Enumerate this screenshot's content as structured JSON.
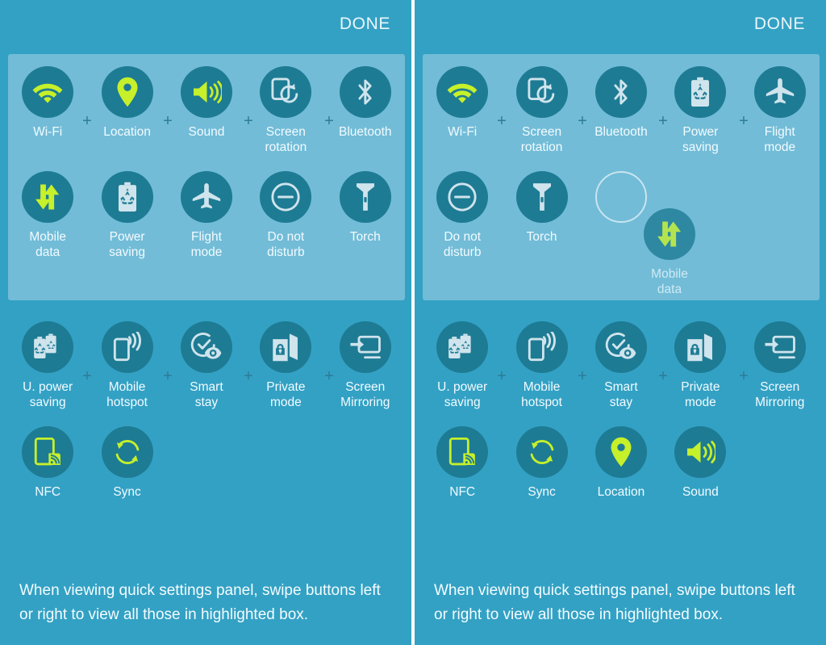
{
  "colors": {
    "panel_bg": "#33a1c4",
    "highlight_bg": "#72bcd7",
    "tile_circle": "#1e7b94",
    "icon_active": "#c6f02a",
    "icon_inactive": "#cfe4ec",
    "label": "#f2fbff",
    "plus": "#2c7c98",
    "divider": "#ffffff"
  },
  "panels": [
    {
      "id": "left-panel",
      "header": {
        "done_label": "DONE"
      },
      "highlight_rows": [
        {
          "tiles": [
            {
              "label": "Wi-Fi",
              "icon": "wifi-icon",
              "state": "active"
            },
            {
              "label": "Location",
              "icon": "location-pin-icon",
              "state": "active"
            },
            {
              "label": "Sound",
              "icon": "sound-speaker-icon",
              "state": "active"
            },
            {
              "label": "Screen\nrotation",
              "icon": "screen-rotation-icon",
              "state": "inactive"
            },
            {
              "label": "Bluetooth",
              "icon": "bluetooth-icon",
              "state": "inactive"
            }
          ]
        },
        {
          "tiles": [
            {
              "label": "Mobile\ndata",
              "icon": "mobile-data-icon",
              "state": "active"
            },
            {
              "label": "Power\nsaving",
              "icon": "power-saving-icon",
              "state": "inactive"
            },
            {
              "label": "Flight\nmode",
              "icon": "flight-mode-icon",
              "state": "inactive"
            },
            {
              "label": "Do not\ndisturb",
              "icon": "do-not-disturb-icon",
              "state": "inactive"
            },
            {
              "label": "Torch",
              "icon": "torch-icon",
              "state": "inactive"
            }
          ]
        }
      ],
      "lower_rows": [
        {
          "tiles": [
            {
              "label": "U. power\nsaving",
              "icon": "ultra-power-saving-icon",
              "state": "inactive"
            },
            {
              "label": "Mobile\nhotspot",
              "icon": "mobile-hotspot-icon",
              "state": "inactive"
            },
            {
              "label": "Smart\nstay",
              "icon": "smart-stay-icon",
              "state": "inactive"
            },
            {
              "label": "Private\nmode",
              "icon": "private-mode-icon",
              "state": "inactive"
            },
            {
              "label": "Screen\nMirroring",
              "icon": "screen-mirroring-icon",
              "state": "inactive"
            }
          ]
        },
        {
          "tiles": [
            {
              "label": "NFC",
              "icon": "nfc-icon",
              "state": "active"
            },
            {
              "label": "Sync",
              "icon": "sync-icon",
              "state": "active"
            },
            {
              "label": "",
              "icon": "",
              "state": "empty"
            },
            {
              "label": "",
              "icon": "",
              "state": "empty"
            },
            {
              "label": "",
              "icon": "",
              "state": "empty"
            }
          ]
        }
      ],
      "plus_marker": "+",
      "caption": "When viewing quick settings panel, swipe buttons left or right to view all those in highlighted box."
    },
    {
      "id": "right-panel",
      "header": {
        "done_label": "DONE"
      },
      "highlight_rows": [
        {
          "tiles": [
            {
              "label": "Wi-Fi",
              "icon": "wifi-icon",
              "state": "active"
            },
            {
              "label": "Screen\nrotation",
              "icon": "screen-rotation-icon",
              "state": "inactive"
            },
            {
              "label": "Bluetooth",
              "icon": "bluetooth-icon",
              "state": "inactive"
            },
            {
              "label": "Power\nsaving",
              "icon": "power-saving-icon",
              "state": "inactive"
            },
            {
              "label": "Flight\nmode",
              "icon": "flight-mode-icon",
              "state": "inactive"
            }
          ]
        },
        {
          "tiles": [
            {
              "label": "Do not\ndisturb",
              "icon": "do-not-disturb-icon",
              "state": "inactive"
            },
            {
              "label": "Torch",
              "icon": "torch-icon",
              "state": "inactive"
            },
            {
              "label": "",
              "icon": "",
              "state": "drop-target"
            },
            {
              "label": "",
              "icon": "",
              "state": "empty"
            },
            {
              "label": "",
              "icon": "",
              "state": "empty"
            }
          ]
        }
      ],
      "dragged_tile": {
        "label": "Mobile\ndata",
        "icon": "mobile-data-icon",
        "state": "active"
      },
      "lower_rows": [
        {
          "tiles": [
            {
              "label": "U. power\nsaving",
              "icon": "ultra-power-saving-icon",
              "state": "inactive"
            },
            {
              "label": "Mobile\nhotspot",
              "icon": "mobile-hotspot-icon",
              "state": "inactive"
            },
            {
              "label": "Smart\nstay",
              "icon": "smart-stay-icon",
              "state": "inactive"
            },
            {
              "label": "Private\nmode",
              "icon": "private-mode-icon",
              "state": "inactive"
            },
            {
              "label": "Screen\nMirroring",
              "icon": "screen-mirroring-icon",
              "state": "inactive"
            }
          ]
        },
        {
          "tiles": [
            {
              "label": "NFC",
              "icon": "nfc-icon",
              "state": "active"
            },
            {
              "label": "Sync",
              "icon": "sync-icon",
              "state": "active"
            },
            {
              "label": "Location",
              "icon": "location-pin-icon",
              "state": "active"
            },
            {
              "label": "Sound",
              "icon": "sound-speaker-icon",
              "state": "active"
            },
            {
              "label": "",
              "icon": "",
              "state": "empty"
            }
          ]
        }
      ],
      "plus_marker": "+",
      "caption": "When viewing quick settings panel, swipe buttons left or right to view all those in highlighted box."
    }
  ]
}
